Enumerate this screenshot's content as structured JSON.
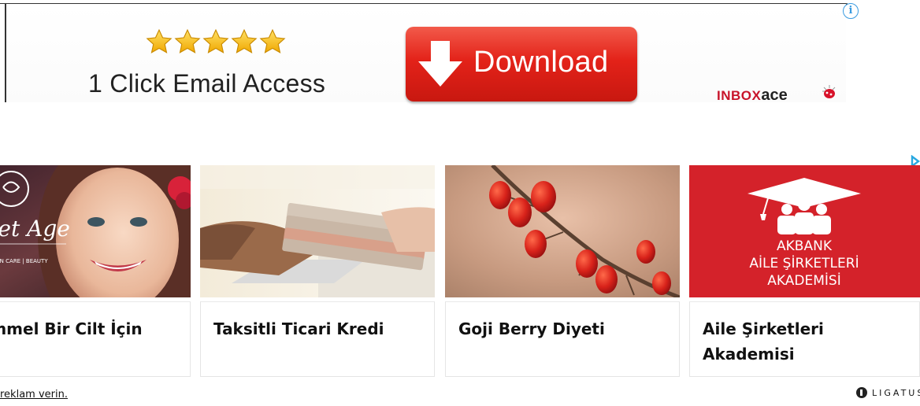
{
  "banner_ad": {
    "info_icon": "info-icon",
    "rating_stars": 5,
    "tagline": "1 Click Email Access",
    "download_label": "Download",
    "brand_box": "INBOX",
    "brand_ace": "ace",
    "colors": {
      "button_red": "#e32219",
      "brand_red": "#c8142a",
      "star_gold": "#f5b800"
    }
  },
  "widget": {
    "cards": [
      {
        "title": "kemmel Bir Cilt İçin",
        "image_text_brand": "ret Age",
        "image_text_tags": "| SKIN CARE | BEAUTY"
      },
      {
        "title": "Taksitli Ticari Kredi"
      },
      {
        "title": "Goji Berry Diyeti"
      },
      {
        "title": "Aile Şirketleri Akademisi",
        "image_lines": [
          "AKBANK",
          "AİLE ŞİRKETLERİ",
          "AKADEMİSİ"
        ]
      }
    ],
    "footer_link": "reklam verin.",
    "provider": "LIGATUS"
  }
}
